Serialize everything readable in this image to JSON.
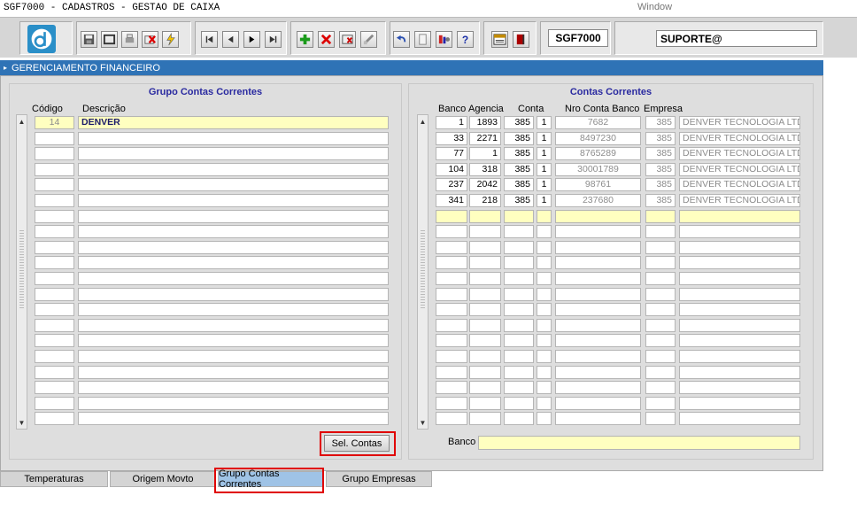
{
  "window": {
    "title": "SGF7000 - CADASTROS - GESTAO DE CAIXA",
    "menu": "Window"
  },
  "toolbar": {
    "form_code": "SGF7000",
    "user": "SUPORTE@"
  },
  "panel": {
    "title": "GERENCIAMENTO FINANCEIRO"
  },
  "left": {
    "title": "Grupo Contas Correntes",
    "headers": {
      "codigo": "Código",
      "descricao": "Descrição"
    },
    "rows": [
      {
        "codigo": "14",
        "descricao": "DENVER"
      }
    ],
    "sel_button": "Sel. Contas"
  },
  "right": {
    "title": "Contas Correntes",
    "headers": {
      "banco": "Banco",
      "agencia": "Agencia",
      "conta": "Conta",
      "nro": "Nro Conta Banco",
      "empresa": "Empresa"
    },
    "rows": [
      {
        "banco": "1",
        "agencia": "1893",
        "conta": "385",
        "dv": "1",
        "nro": "7682",
        "empresa": "385",
        "empresa_nome": "DENVER TECNOLOGIA LTDA"
      },
      {
        "banco": "33",
        "agencia": "2271",
        "conta": "385",
        "dv": "1",
        "nro": "8497230",
        "empresa": "385",
        "empresa_nome": "DENVER TECNOLOGIA LTDA"
      },
      {
        "banco": "77",
        "agencia": "1",
        "conta": "385",
        "dv": "1",
        "nro": "8765289",
        "empresa": "385",
        "empresa_nome": "DENVER TECNOLOGIA LTDA"
      },
      {
        "banco": "104",
        "agencia": "318",
        "conta": "385",
        "dv": "1",
        "nro": "30001789",
        "empresa": "385",
        "empresa_nome": "DENVER TECNOLOGIA LTDA"
      },
      {
        "banco": "237",
        "agencia": "2042",
        "conta": "385",
        "dv": "1",
        "nro": "98761",
        "empresa": "385",
        "empresa_nome": "DENVER TECNOLOGIA LTDA"
      },
      {
        "banco": "341",
        "agencia": "218",
        "conta": "385",
        "dv": "1",
        "nro": "237680",
        "empresa": "385",
        "empresa_nome": "DENVER TECNOLOGIA LTDA"
      }
    ],
    "footer_label": "Banco"
  },
  "tabs": [
    {
      "label": "Temperaturas",
      "active": false
    },
    {
      "label": "Origem Movto",
      "active": false
    },
    {
      "label": "Grupo Contas Correntes",
      "active": true
    },
    {
      "label": "Grupo Empresas",
      "active": false
    }
  ],
  "icons": [
    "logo-icon",
    "save-icon",
    "window-icon",
    "print-icon",
    "delete-record-icon",
    "run-icon",
    "first-record-icon",
    "previous-record-icon",
    "next-record-icon",
    "last-record-icon",
    "insert-record-icon",
    "remove-record-icon",
    "query-icon",
    "edit-icon",
    "undo-icon",
    "copy-icon",
    "options-icon",
    "help-icon",
    "calendar-icon",
    "exit-icon"
  ],
  "colors": {
    "accent": "#2f73b6",
    "highlight": "#ffffc0",
    "annotation": "#e00000",
    "active_tab": "#9fc3e6"
  }
}
